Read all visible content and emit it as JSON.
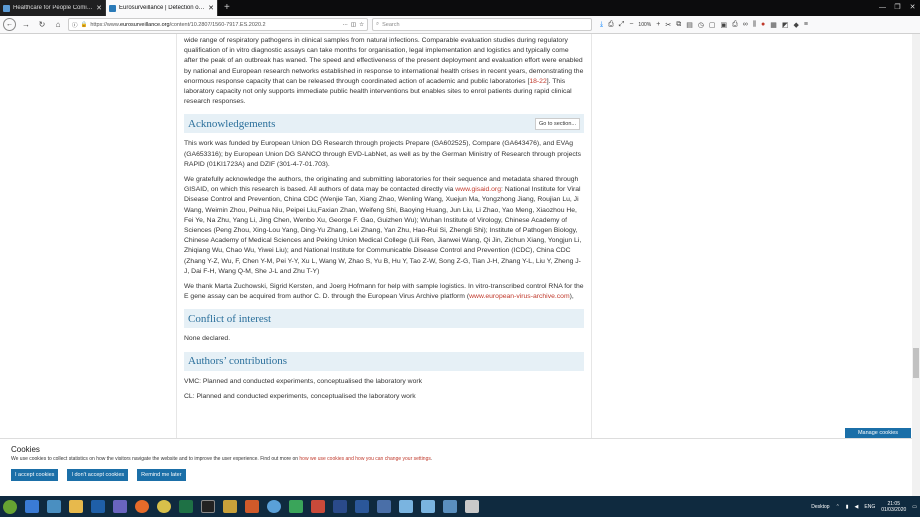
{
  "tabs": [
    {
      "title": "Healthcare for People Coming",
      "active": false,
      "favicon_color": "#5b9bd5"
    },
    {
      "title": "Eurosurveillance | Detection of 2",
      "active": true,
      "favicon_color": "#2a7ab8"
    }
  ],
  "url": {
    "prefix": "https://www.",
    "domain": "eurosurveillance.org",
    "path": "/content/10.2807/1560-7917.ES.2020.2"
  },
  "search_placeholder": "Search",
  "zoom": "100%",
  "article": {
    "intro_text": "wide range of respiratory pathogens in clinical samples from natural infections. Comparable evaluation studies during regulatory qualification of in vitro diagnostic assays can take months for organisation, legal implementation and logistics and typically come after the peak of an outbreak has waned. The speed and effectiveness of the present deployment and evaluation effort were enabled by national and European research networks established in response to international health crises in recent years, demonstrating the enormous response capacity that can be released through coordinated action of academic and public laboratories [",
    "intro_ref": "18-22",
    "intro_tail": "]. This laboratory capacity not only supports immediate public health interventions but enables sites to enrol patients during rapid clinical research responses.",
    "ack_title": "Acknowledgements",
    "goto_label": "Go to section...",
    "ack_p1": "This work was funded by European Union DG Research through projects Prepare (GA602525), Compare (GA643476), and EVAg (GA653316); by European Union DG SANCO through EVD-LabNet, as well as by the German Ministry of Research through projects RAPID (01KI1723A) and DZIF (301-4-7-01.703).",
    "ack_p2_a": "We gratefully acknowledge the authors, the originating and submitting laboratories for their sequence and metadata shared through GISAID, on which this research is based. All authors of data may be contacted directly via ",
    "ack_p2_link": "www.gisaid.org",
    "ack_p2_b": ": National Institute for Viral Disease Control and Prevention, China CDC (Wenjie Tan, Xiang Zhao, Wenling Wang, Xuejun Ma, Yongzhong Jiang, Roujian Lu, Ji Wang, Weimin Zhou, Peihua Niu, Peipei Liu,Faxian Zhan, Weifeng Shi, Baoying Huang, Jun Liu, Li Zhao, Yao Meng, Xiaozhou He, Fei Ye, Na Zhu, Yang Li, Jing Chen, Wenbo Xu, George F. Gao, Guizhen Wu); Wuhan Institute of Virology, Chinese Academy of Sciences (Peng Zhou, Xing-Lou Yang, Ding-Yu Zhang, Lei Zhang, Yan Zhu, Hao-Rui Si, Zhengli Shi); Institute of Pathogen Biology, Chinese Academy of Medical Sciences and Peking Union Medical College (Lili Ren, Jianwei Wang, Qi Jin, Zichun Xiang, Yongjun Li, Zhiqiang Wu, Chao Wu, Yiwei Liu); and National Institute for Communicable Disease Control and Prevention (ICDC), China CDC (Zhang Y-Z, Wu, F, Chen Y-M, Pei Y-Y, Xu L, Wang W, Zhao S, Yu B, Hu Y, Tao Z-W, Song Z-G, Tian J-H, Zhang Y-L, Liu Y, Zheng J-J, Dai F-H, Wang Q-M, She J-L and Zhu T-Y)",
    "ack_p3_a": "We thank Marta Zuchowski, Sigrid Kersten, and Joerg Hofmann for help with sample logistics. In vitro-transcribed control RNA for the E gene assay can be acquired from author C. D. through the European Virus Archive platform (",
    "ack_p3_link": "www.european-virus-archive.com",
    "ack_p3_b": "),",
    "coi_title": "Conflict of interest",
    "coi_text": "None declared.",
    "contrib_title": "Authors’ contributions",
    "contrib_1": "VMC: Planned and conducted experiments, conceptualised the laboratory work",
    "contrib_2": "CL: Planned and conducted experiments, conceptualised the laboratory work"
  },
  "manage_cookies": "Manage cookies",
  "cookie": {
    "title": "Cookies",
    "text": "We use cookies to collect statistics on how the visitors navigate the website and to improve the user experience. Find out more on ",
    "link": "how we use cookies and how you can change your settings",
    "text_end": ".",
    "accept": "I accept cookies",
    "reject": "I don't accept cookies",
    "remind": "Remind me later"
  },
  "taskbar": {
    "desktop_label": "Desktop",
    "lang": "ENG",
    "time": "21:05",
    "date": "01/03/2020"
  }
}
